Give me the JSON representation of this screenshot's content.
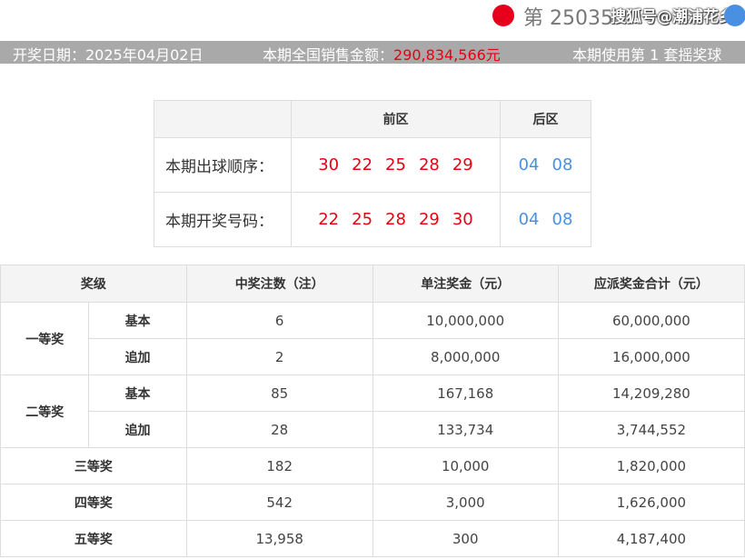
{
  "header": {
    "issue": "第 25035",
    "watermark": "搜狐号@潮浦花乡"
  },
  "info": {
    "draw_date": "开奖日期：2025年04月02日",
    "sales_label": "本期全国销售金额：",
    "sales_amount": "290,834,566元",
    "machine": "本期使用第 1 套摇奖球"
  },
  "balls": {
    "front_header": "前区",
    "back_header": "后区",
    "order_label": "本期出球顺序：",
    "order_front": [
      "30",
      "22",
      "25",
      "28",
      "29"
    ],
    "order_back": [
      "04",
      "08"
    ],
    "result_label": "本期开奖号码：",
    "result_front": [
      "22",
      "25",
      "28",
      "29",
      "30"
    ],
    "result_back": [
      "04",
      "08"
    ]
  },
  "prize_table": {
    "headers": [
      "奖级",
      "中奖注数（注）",
      "单注奖金（元）",
      "应派奖金合计（元）"
    ],
    "first": {
      "name": "一等奖",
      "basic": {
        "label": "基本",
        "count": "6",
        "single": "10,000,000",
        "total": "60,000,000"
      },
      "extra": {
        "label": "追加",
        "count": "2",
        "single": "8,000,000",
        "total": "16,000,000"
      }
    },
    "second": {
      "name": "二等奖",
      "basic": {
        "label": "基本",
        "count": "85",
        "single": "167,168",
        "total": "14,209,280"
      },
      "extra": {
        "label": "追加",
        "count": "28",
        "single": "133,734",
        "total": "3,744,552"
      }
    },
    "third": {
      "name": "三等奖",
      "count": "182",
      "single": "10,000",
      "total": "1,820,000"
    },
    "fourth": {
      "name": "四等奖",
      "count": "542",
      "single": "3,000",
      "total": "1,626,000"
    },
    "fifth": {
      "name": "五等奖",
      "count": "13,958",
      "single": "300",
      "total": "4,187,400"
    }
  }
}
